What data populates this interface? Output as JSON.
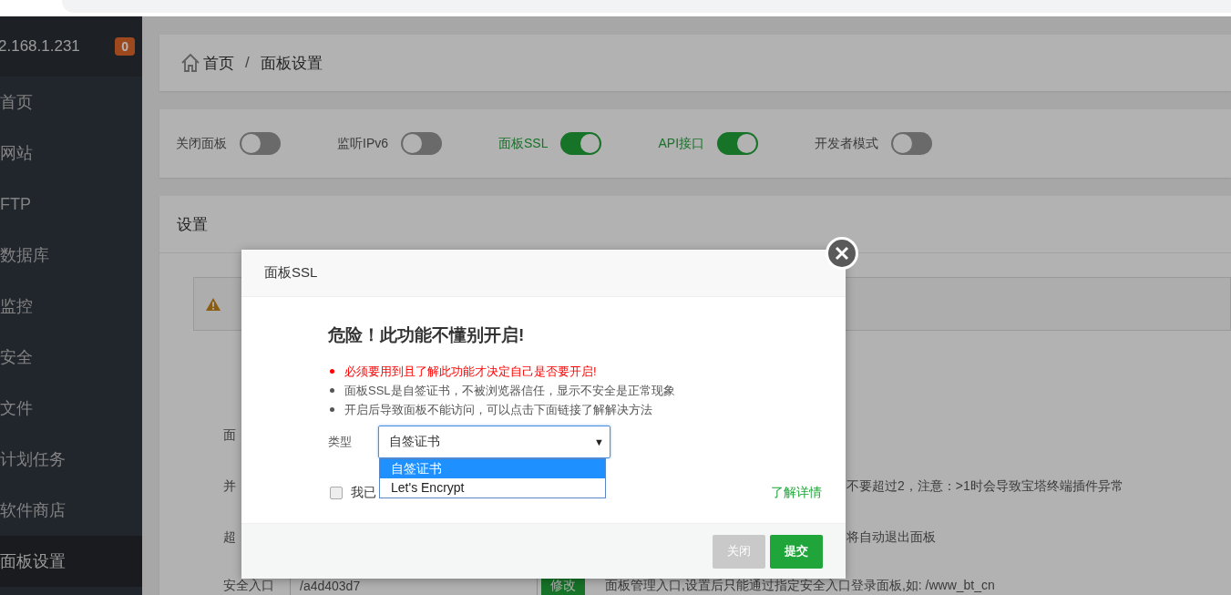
{
  "sidebar": {
    "host": "2.168.1.231",
    "badge": "0",
    "items": [
      {
        "label": "首页",
        "selected": false
      },
      {
        "label": "网站",
        "selected": false
      },
      {
        "label": "FTP",
        "selected": false
      },
      {
        "label": "数据库",
        "selected": false
      },
      {
        "label": "监控",
        "selected": false
      },
      {
        "label": "安全",
        "selected": false
      },
      {
        "label": "文件",
        "selected": false
      },
      {
        "label": "计划任务",
        "selected": false
      },
      {
        "label": "软件商店",
        "selected": false
      },
      {
        "label": "面板设置",
        "selected": true
      }
    ]
  },
  "breadcrumb": {
    "home": "首页",
    "separator": "/",
    "current": "面板设置"
  },
  "toggles": [
    {
      "label": "关闭面板",
      "on": false
    },
    {
      "label": "监听IPv6",
      "on": false
    },
    {
      "label": "面板SSL",
      "on": true
    },
    {
      "label": "API接口",
      "on": true
    },
    {
      "label": "开发者模式",
      "on": false
    }
  ],
  "settings": {
    "title": "设置",
    "rows": [
      {
        "kind": "label",
        "label": "面"
      },
      {
        "kind": "note",
        "label": "并",
        "note": "不要超过2，注意：>1时会导致宝塔终端插件异常"
      },
      {
        "kind": "note",
        "label": "超",
        "note": "将自动退出面板"
      },
      {
        "kind": "entry",
        "label": "安全入口",
        "value": "/a4d403d7",
        "button": "修改",
        "note": "面板管理入口,设置后只能通过指定安全入口登录面板,如: /www_bt_cn"
      }
    ]
  },
  "dialog": {
    "title": "面板SSL",
    "heading": "危险！此功能不懂别开启!",
    "bullets": [
      {
        "text": "必须要用到且了解此功能才决定自己是否要开启!",
        "warning": true
      },
      {
        "text": "面板SSL是自签证书，不被浏览器信任，显示不安全是正常现象",
        "warning": false
      },
      {
        "text": "开启后导致面板不能访问，可以点击下面链接了解解决方法",
        "warning": false
      }
    ],
    "type_label": "类型",
    "select": {
      "value": "自签证书",
      "caret": "▼",
      "options": [
        {
          "label": "自签证书",
          "selected": true
        },
        {
          "label": "Let's Encrypt",
          "selected": false
        }
      ]
    },
    "agree": {
      "label": "我已",
      "checked": false
    },
    "link": "了解详情",
    "buttons": [
      {
        "label": "关闭",
        "kind": "secondary"
      },
      {
        "label": "提交",
        "kind": "primary"
      }
    ]
  }
}
